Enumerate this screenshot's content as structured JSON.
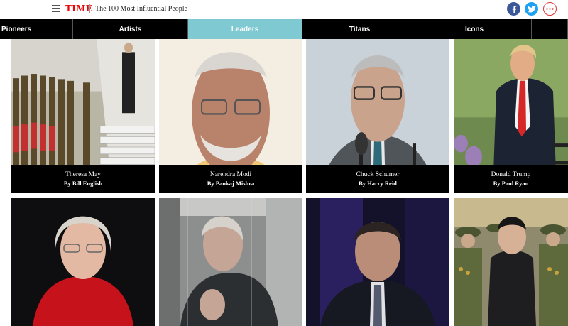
{
  "header": {
    "logo": "TIME",
    "subtitle": "The 100 Most Influential People"
  },
  "tabs": [
    {
      "label": "Pioneers",
      "active": false
    },
    {
      "label": "Artists",
      "active": false
    },
    {
      "label": "Leaders",
      "active": true
    },
    {
      "label": "Titans",
      "active": false
    },
    {
      "label": "Icons",
      "active": false
    },
    {
      "label": "",
      "active": false
    }
  ],
  "cards": [
    {
      "name": "Theresa May",
      "byline": "By Bill English"
    },
    {
      "name": "Narendra Modi",
      "byline": "By Pankaj Mishra"
    },
    {
      "name": "Chuck Schumer",
      "byline": "By Harry Reid"
    },
    {
      "name": "Donald Trump",
      "byline": "By Paul Ryan"
    },
    {
      "name": "",
      "byline": ""
    },
    {
      "name": "",
      "byline": ""
    },
    {
      "name": "",
      "byline": ""
    },
    {
      "name": "",
      "byline": ""
    }
  ],
  "colors": {
    "brand_red": "#e90606",
    "active_tab": "#7fc9d2",
    "facebook": "#3b5998",
    "twitter": "#1da1f2"
  },
  "icons": [
    "menu-icon",
    "facebook-icon",
    "twitter-icon",
    "more-icon"
  ]
}
